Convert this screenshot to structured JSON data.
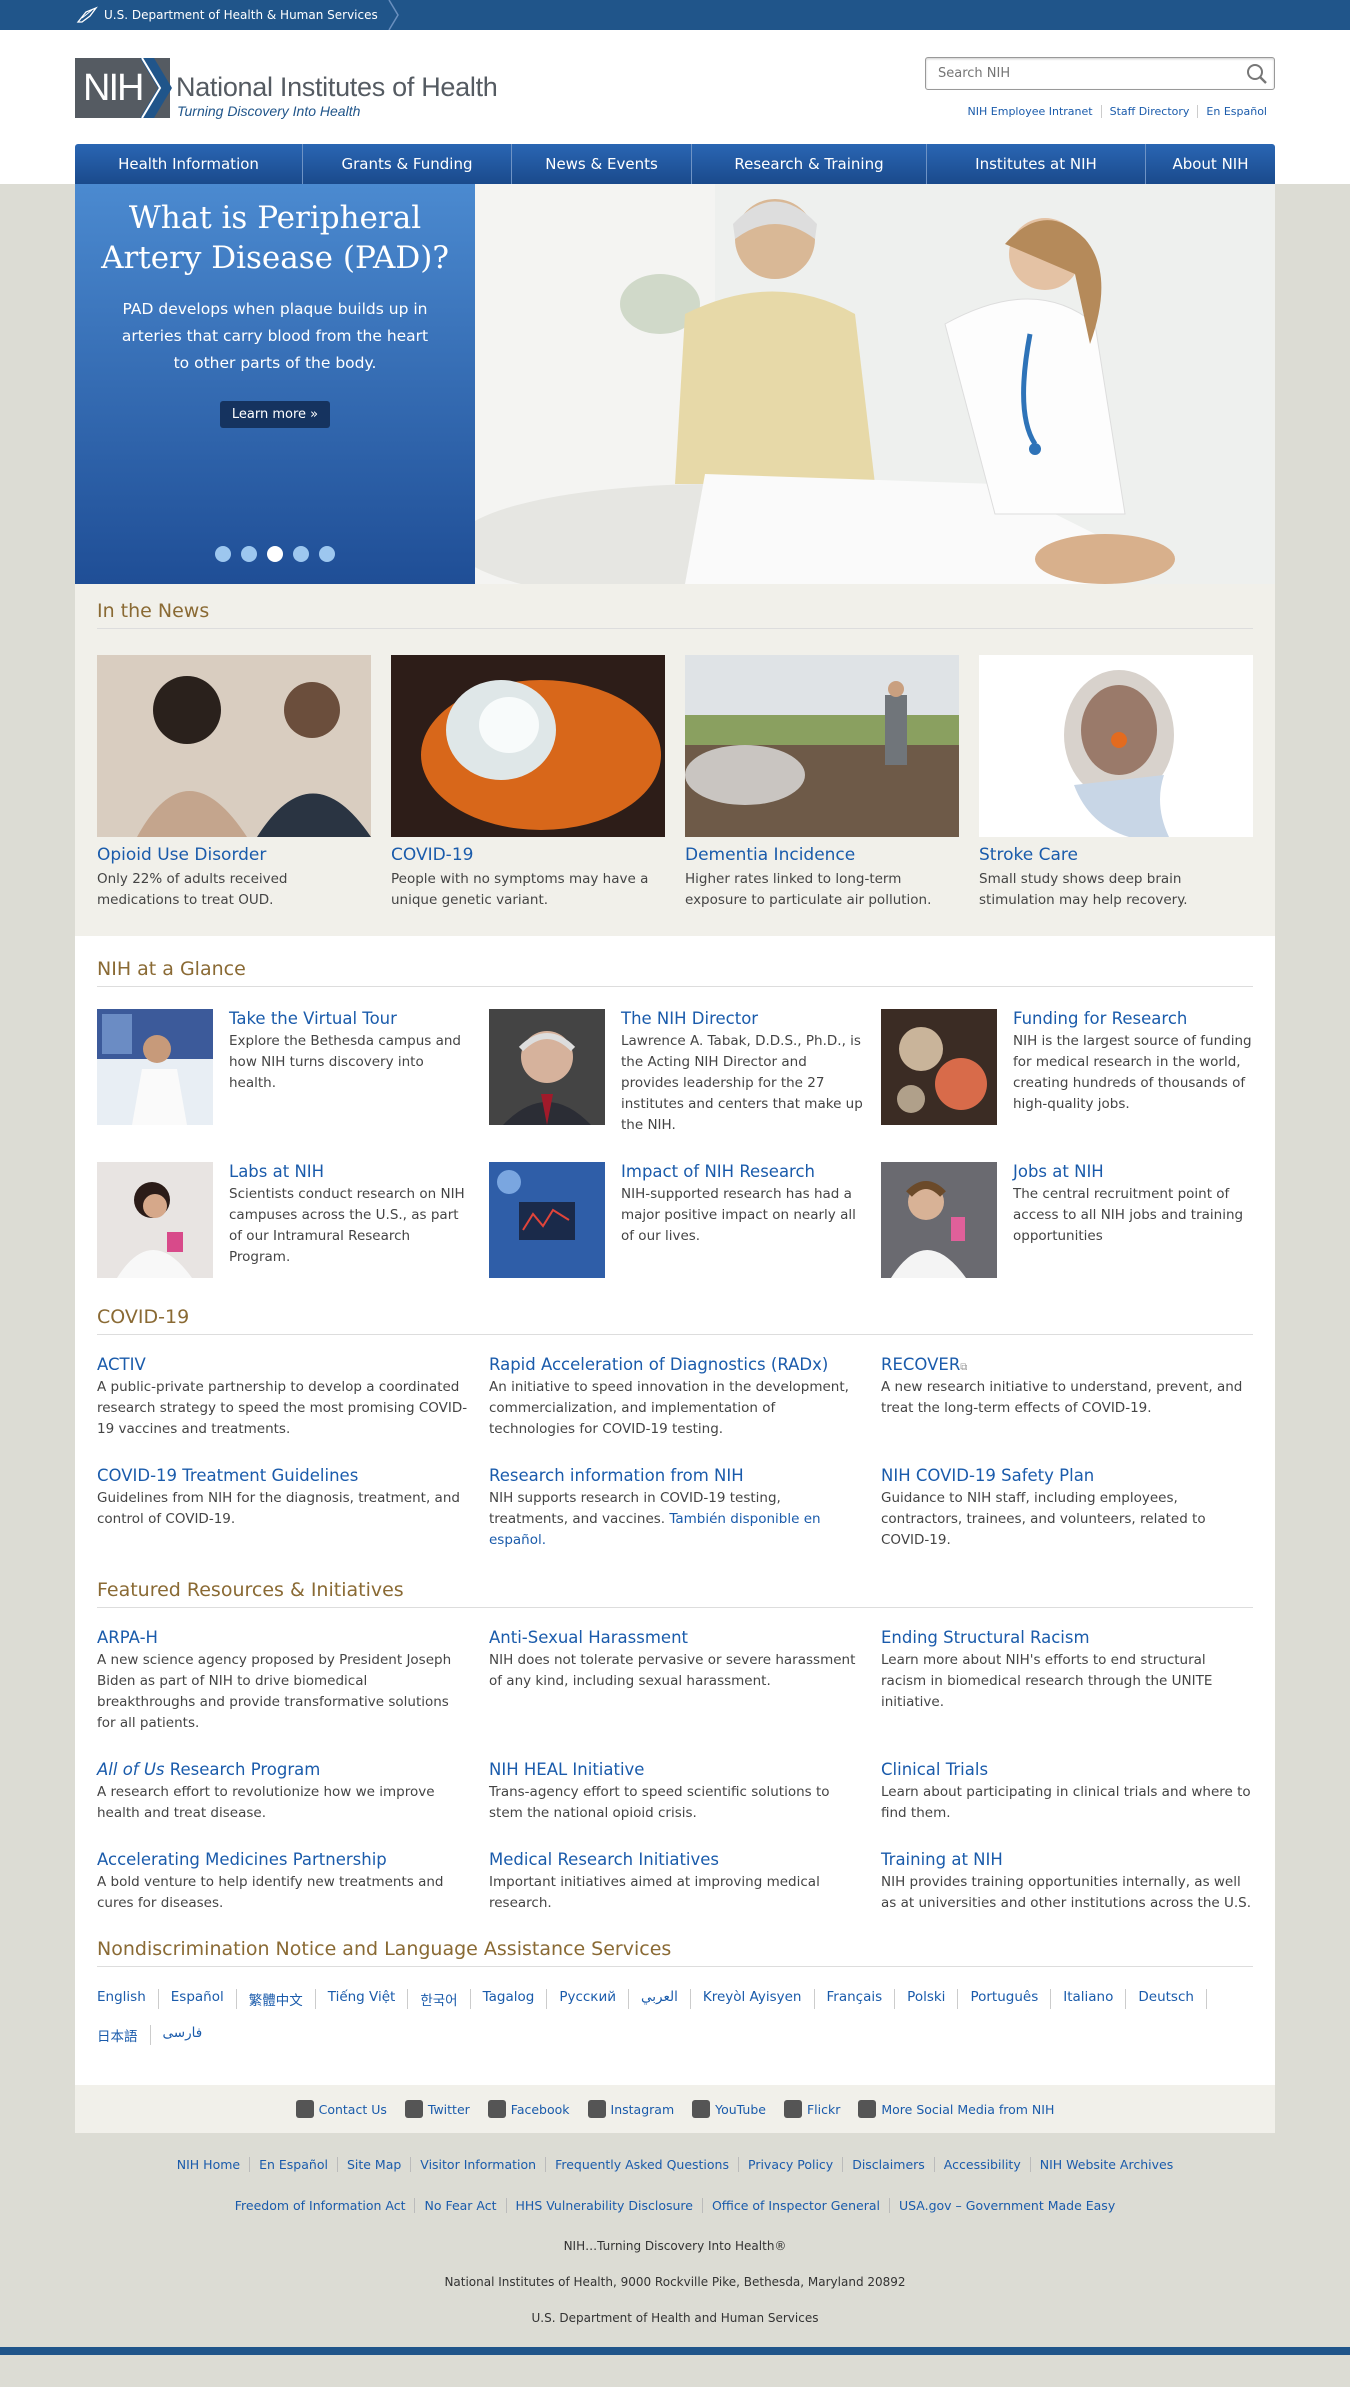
{
  "hhs_bar": {
    "label": "U.S. Department of Health & Human Services"
  },
  "logo": {
    "mark": "NIH",
    "title": "National Institutes of Health",
    "tagline": "Turning Discovery Into Health"
  },
  "search": {
    "placeholder": "Search NIH"
  },
  "utility_links": [
    "NIH Employee Intranet",
    "Staff Directory",
    "En Español"
  ],
  "nav": [
    "Health Information",
    "Grants & Funding",
    "News & Events",
    "Research & Training",
    "Institutes at NIH",
    "About NIH"
  ],
  "hero": {
    "title": "What is Peripheral Artery Disease (PAD)?",
    "body": "PAD develops when plaque builds up in arteries that carry blood from the heart to other parts of the body.",
    "button": "Learn more »",
    "active_slide": 3,
    "slide_count": 5
  },
  "news": {
    "title": "In the News",
    "items": [
      {
        "title": "Opioid Use Disorder",
        "text": "Only 22% of adults received medications to treat OUD."
      },
      {
        "title": "COVID-19",
        "text": "People with no symptoms may have a unique genetic variant."
      },
      {
        "title": "Dementia Incidence",
        "text": "Higher rates linked to long-term exposure to particulate air pollution."
      },
      {
        "title": "Stroke Care",
        "text": "Small study shows deep brain stimulation may help recovery."
      }
    ]
  },
  "glance": {
    "title": "NIH at a Glance",
    "items": [
      {
        "title": "Take the Virtual Tour",
        "text": "Explore the Bethesda campus and how NIH turns discovery into health."
      },
      {
        "title": "The NIH Director",
        "text": "Lawrence A. Tabak, D.D.S., Ph.D., is the Acting NIH Director and provides leadership for the 27 institutes and centers that make up the NIH."
      },
      {
        "title": "Funding for Research",
        "text": "NIH is the largest source of funding for medical research in the world, creating hundreds of thousands of high-quality jobs."
      },
      {
        "title": "Labs at NIH",
        "text": "Scientists conduct research on NIH campuses across the U.S., as part of our Intramural Research Program."
      },
      {
        "title": "Impact of NIH Research",
        "text": "NIH-supported research has had a major positive impact on nearly all of our lives."
      },
      {
        "title": "Jobs at NIH",
        "text": "The central recruitment point of access to all NIH jobs and training opportunities"
      }
    ]
  },
  "covid": {
    "title": "COVID-19",
    "items": [
      {
        "title": "ACTIV",
        "text": "A public-private partnership to develop a coordinated research strategy to speed the most promising COVID-19 vaccines and treatments."
      },
      {
        "title": "Rapid Acceleration of Diagnostics (RADx)",
        "text": "An initiative to speed innovation in the development, commercialization, and implementation of technologies for COVID-19 testing."
      },
      {
        "title": "RECOVER",
        "text": "A new research initiative to understand, prevent, and treat the long-term effects of COVID-19."
      },
      {
        "title": "COVID-19 Treatment Guidelines",
        "text": "Guidelines from NIH for the diagnosis, treatment, and control of COVID-19."
      },
      {
        "title": "Research information from NIH",
        "text": "NIH supports research in COVID-19 testing, treatments, and vaccines.",
        "link": "También disponible en español."
      },
      {
        "title": "NIH COVID-19 Safety Plan",
        "text": "Guidance to NIH staff, including employees, contractors, trainees, and volunteers, related to COVID-19."
      }
    ]
  },
  "featured": {
    "title": "Featured Resources & Initiatives",
    "items": [
      {
        "title": "ARPA-H",
        "text": "A new science agency proposed by President Joseph Biden as part of NIH to drive biomedical breakthroughs and provide transformative solutions for all patients."
      },
      {
        "title": "Anti-Sexual Harassment",
        "text": "NIH does not tolerate pervasive or severe harassment of any kind, including sexual harassment."
      },
      {
        "title": "Ending Structural Racism",
        "text": "Learn more about NIH's efforts to end structural racism in biomedical research through the UNITE initiative."
      },
      {
        "title_italic": "All of Us",
        "title": " Research Program",
        "text": "A research effort to revolutionize how we improve health and treat disease."
      },
      {
        "title": "NIH HEAL Initiative",
        "text": "Trans-agency effort to speed scientific solutions to stem the national opioid crisis."
      },
      {
        "title": "Clinical Trials",
        "text": "Learn about participating in clinical trials and where to find them."
      },
      {
        "title": "Accelerating Medicines Partnership",
        "text": "A bold venture to help identify new treatments and cures for diseases."
      },
      {
        "title": "Medical Research Initiatives",
        "text": "Important initiatives aimed at improving medical research."
      },
      {
        "title": "Training at NIH",
        "text": "NIH provides training opportunities internally, as well as at universities and other institutions across the U.S."
      }
    ]
  },
  "nondiscrimination": {
    "title": "Nondiscrimination Notice and Language Assistance Services",
    "languages": [
      "English",
      "Español",
      "繁體中文",
      "Tiếng Việt",
      "한국어",
      "Tagalog",
      "Русский",
      "العربي",
      "Kreyòl Ayisyen",
      "Français",
      "Polski",
      "Português",
      "Italiano",
      "Deutsch",
      "日本語",
      "فارسی"
    ]
  },
  "social": [
    "Contact Us",
    "Twitter",
    "Facebook",
    "Instagram",
    "YouTube",
    "Flickr",
    "More Social Media from NIH"
  ],
  "footer": {
    "row1": [
      "NIH Home",
      "En Español",
      "Site Map",
      "Visitor Information",
      "Frequently Asked Questions",
      "Privacy Policy",
      "Disclaimers",
      "Accessibility",
      "NIH Website Archives"
    ],
    "row2": [
      "Freedom of Information Act",
      "No Fear Act",
      "HHS Vulnerability Disclosure",
      "Office of Inspector General",
      "USA.gov – Government Made Easy"
    ],
    "tagline": "NIH…Turning Discovery Into Health®",
    "address": "National Institutes of Health, 9000 Rockville Pike, Bethesda, Maryland 20892",
    "hhs": "U.S. Department of Health and Human Services"
  }
}
